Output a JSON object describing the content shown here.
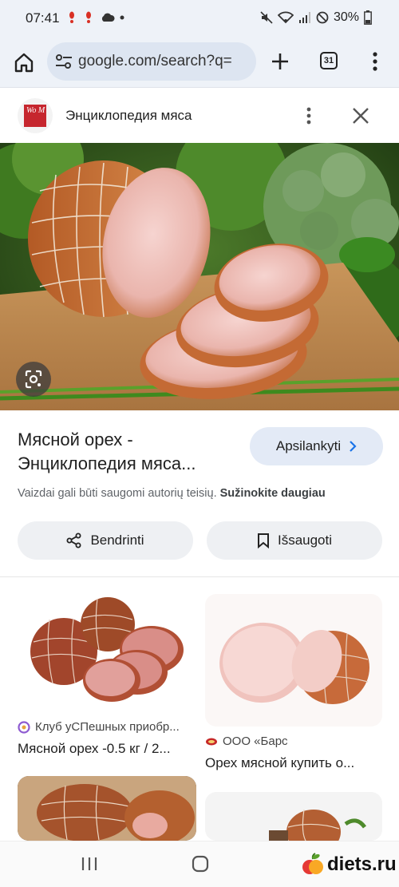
{
  "status_bar": {
    "time": "07:41",
    "battery": "30%"
  },
  "browser": {
    "url": "google.com/search?q=",
    "tab_count": "31"
  },
  "panel": {
    "site_name": "Энциклопедия мяса",
    "logo_text": "Wo M"
  },
  "result": {
    "title": "Мясной орех - Энциклопедия мяса...",
    "visit_label": "Apsilankyti",
    "copyright_text": "Vaizdai gali būti saugomi autorių teisių.",
    "learn_more": "Sužinokite daugiau",
    "share_label": "Bendrinti",
    "save_label": "Išsaugoti"
  },
  "related": [
    {
      "source": "Клуб уСПешных приобр...",
      "title": "Мясной орех -0.5 кг / 2..."
    },
    {
      "source": "ООО «Барс",
      "title": "Орех мясной купить о..."
    }
  ],
  "watermark": "diets.ru",
  "colors": {
    "accent_blue": "#1a73e8",
    "chip_bg": "#e3eaf6",
    "toolbar_bg": "#eef2f8"
  }
}
